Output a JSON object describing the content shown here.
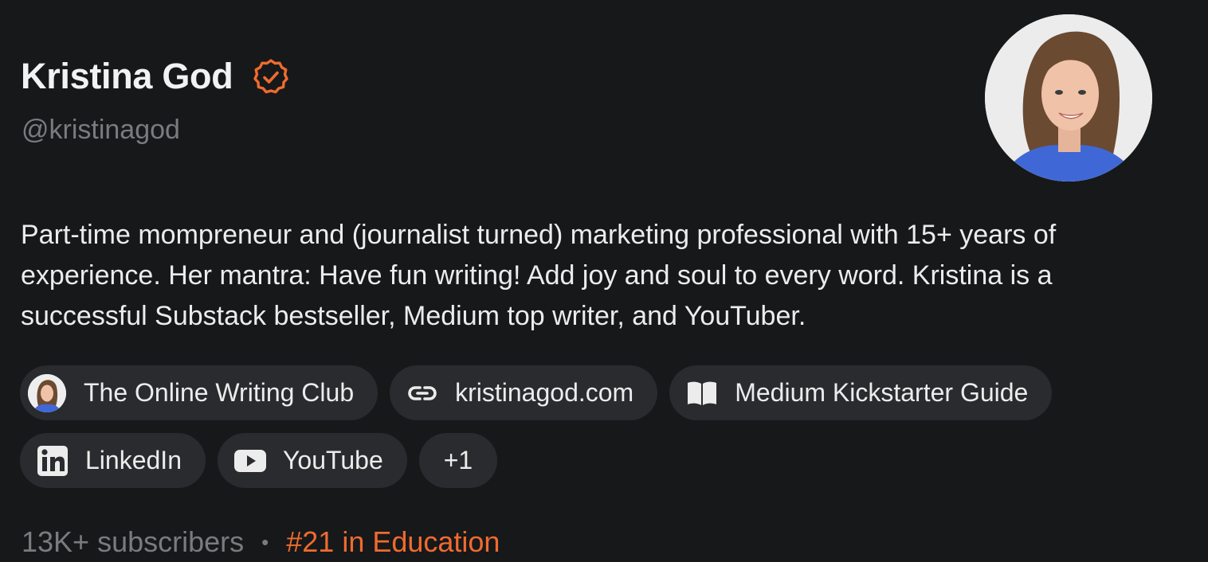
{
  "profile": {
    "name": "Kristina God",
    "handle": "@kristinagod",
    "bio": "Part-time mompreneur and (journalist turned) marketing professional with 15+ years of experience. Her mantra: Have fun writing! Add joy and soul to every word. Kristina is a successful Substack bestseller, Medium top writer, and YouTuber.",
    "verified_icon": "verified-badge-icon",
    "accent_color": "#ef6b2e"
  },
  "links": {
    "row1": [
      {
        "label": "The Online Writing Club",
        "icon": "publication-avatar"
      },
      {
        "label": "kristinagod.com",
        "icon": "link-icon"
      },
      {
        "label": "Medium Kickstarter Guide",
        "icon": "book-icon"
      }
    ],
    "row2": [
      {
        "label": "LinkedIn",
        "icon": "linkedin-icon"
      },
      {
        "label": "YouTube",
        "icon": "youtube-icon"
      },
      {
        "label": "+1",
        "icon": ""
      }
    ]
  },
  "stats": {
    "subscribers": "13K+ subscribers",
    "separator": "•",
    "rank": "#21 in Education"
  }
}
